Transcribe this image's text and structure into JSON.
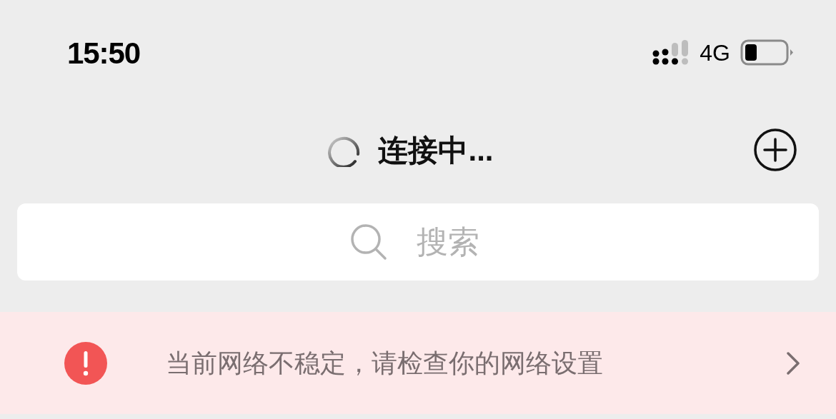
{
  "status_bar": {
    "time": "15:50",
    "network": "4G"
  },
  "header": {
    "title": "连接中..."
  },
  "search": {
    "placeholder": "搜索"
  },
  "network_alert": {
    "message": "当前网络不稳定，请检查你的网络设置"
  }
}
